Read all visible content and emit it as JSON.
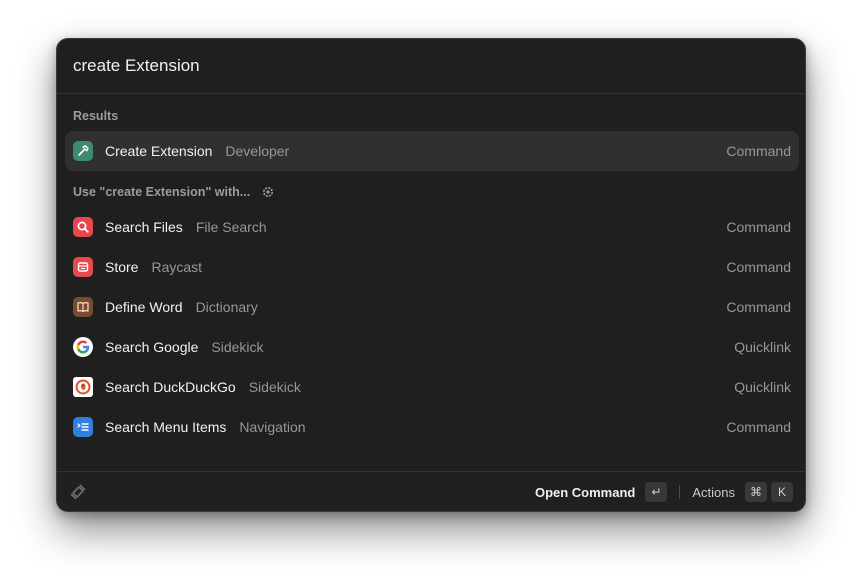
{
  "search": {
    "value": "create Extension"
  },
  "sections": {
    "results_title": "Results",
    "fallback_title": "Use \"create Extension\" with..."
  },
  "results": [
    {
      "title": "Create Extension",
      "subtitle": "Developer",
      "accessory": "Command",
      "icon": "hammer-icon",
      "color": "#3e8a73"
    }
  ],
  "fallbacks": [
    {
      "title": "Search Files",
      "subtitle": "File Search",
      "accessory": "Command",
      "icon": "magnifier-icon",
      "color": "#e5484d"
    },
    {
      "title": "Store",
      "subtitle": "Raycast",
      "accessory": "Command",
      "icon": "store-icon",
      "color": "#e5484d"
    },
    {
      "title": "Define Word",
      "subtitle": "Dictionary",
      "accessory": "Command",
      "icon": "book-icon",
      "color": "#7a4a2e"
    },
    {
      "title": "Search Google",
      "subtitle": "Sidekick",
      "accessory": "Quicklink",
      "icon": "google-icon",
      "color": "#ffffff"
    },
    {
      "title": "Search DuckDuckGo",
      "subtitle": "Sidekick",
      "accessory": "Quicklink",
      "icon": "duckduckgo-icon",
      "color": "#de5833"
    },
    {
      "title": "Search Menu Items",
      "subtitle": "Navigation",
      "accessory": "Command",
      "icon": "menu-list-icon",
      "color": "#2f7ee0"
    }
  ],
  "footer": {
    "primary_action": "Open Command",
    "primary_key": "↵",
    "secondary_action": "Actions",
    "secondary_keys": [
      "⌘",
      "K"
    ]
  }
}
